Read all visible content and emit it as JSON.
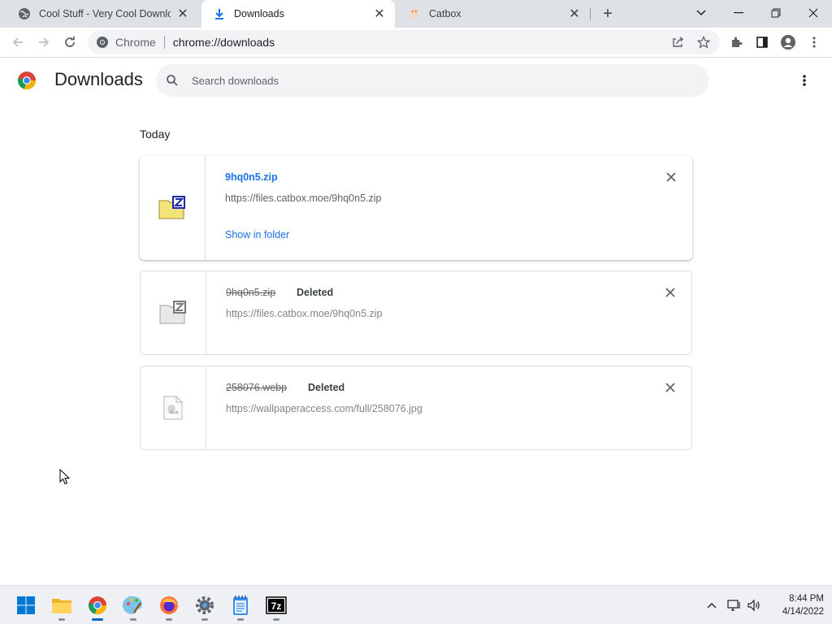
{
  "tabs": [
    {
      "title": "Cool Stuff - Very Cool Downloads",
      "icon": "globe-icon",
      "active": false
    },
    {
      "title": "Downloads",
      "icon": "download-icon",
      "active": true
    },
    {
      "title": "Catbox",
      "icon": "catbox-icon",
      "active": false
    }
  ],
  "toolbar": {
    "site_label": "Chrome",
    "url": "chrome://downloads"
  },
  "page": {
    "title": "Downloads",
    "search_placeholder": "Search downloads",
    "section": "Today"
  },
  "downloads": [
    {
      "filename": "9hq0n5.zip",
      "url": "https://files.catbox.moe/9hq0n5.zip",
      "action": "Show in folder",
      "status": "",
      "icon": "zip-archive-icon"
    },
    {
      "filename": "9hq0n5.zip",
      "url": "https://files.catbox.moe/9hq0n5.zip",
      "status": "Deleted",
      "icon": "zip-archive-icon"
    },
    {
      "filename": "258076.webp",
      "url": "https://wallpaperaccess.com/full/258076.jpg",
      "status": "Deleted",
      "icon": "image-file-icon"
    }
  ],
  "taskbar": {
    "apps": [
      "start-button",
      "file-explorer",
      "chrome",
      "paint",
      "firefox",
      "settings",
      "notepad",
      "7zip"
    ],
    "time": "8:44 PM",
    "date": "4/14/2022"
  },
  "colors": {
    "accent": "#1a73e8",
    "tabstrip": "#dee1e6",
    "taskbar": "#eef0f3"
  }
}
